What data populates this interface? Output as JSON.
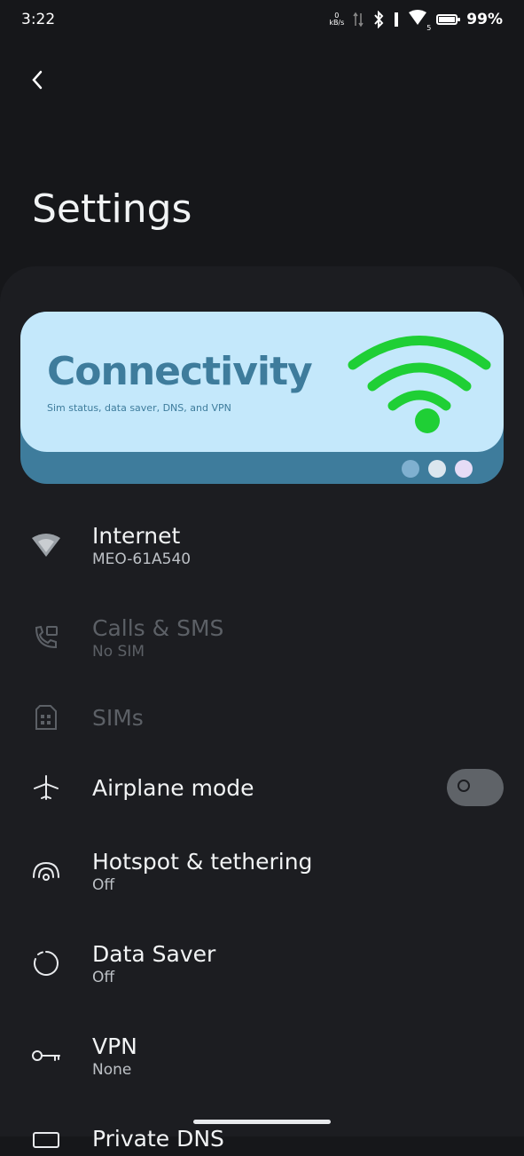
{
  "status": {
    "time": "3:22",
    "netspeed_value": "0",
    "netspeed_unit": "kB/s",
    "battery": "99%",
    "signal_badge": "5"
  },
  "header": {
    "title": "Settings"
  },
  "banner": {
    "title": "Connectivity",
    "subtitle": "Sim status, data saver, DNS, and VPN",
    "dot_colors": [
      "#7fb0d0",
      "#dbe6ee",
      "#e6dcf6"
    ],
    "wifi_color": "#1fcf35"
  },
  "items": [
    {
      "title": "Internet",
      "subtitle": "MEO-61A540",
      "icon": "wifi-icon"
    },
    {
      "title": "Calls & SMS",
      "subtitle": "No SIM",
      "icon": "phone-message-icon"
    },
    {
      "title": "SIMs",
      "subtitle": "",
      "icon": "sim-card-icon"
    },
    {
      "title": "Airplane mode",
      "subtitle": "",
      "icon": "airplane-icon"
    },
    {
      "title": "Hotspot & tethering",
      "subtitle": "Off",
      "icon": "hotspot-icon"
    },
    {
      "title": "Data Saver",
      "subtitle": "Off",
      "icon": "data-saver-icon"
    },
    {
      "title": "VPN",
      "subtitle": "None",
      "icon": "vpn-key-icon"
    },
    {
      "title": "Private DNS",
      "subtitle": "",
      "icon": "private-dns-icon"
    }
  ]
}
